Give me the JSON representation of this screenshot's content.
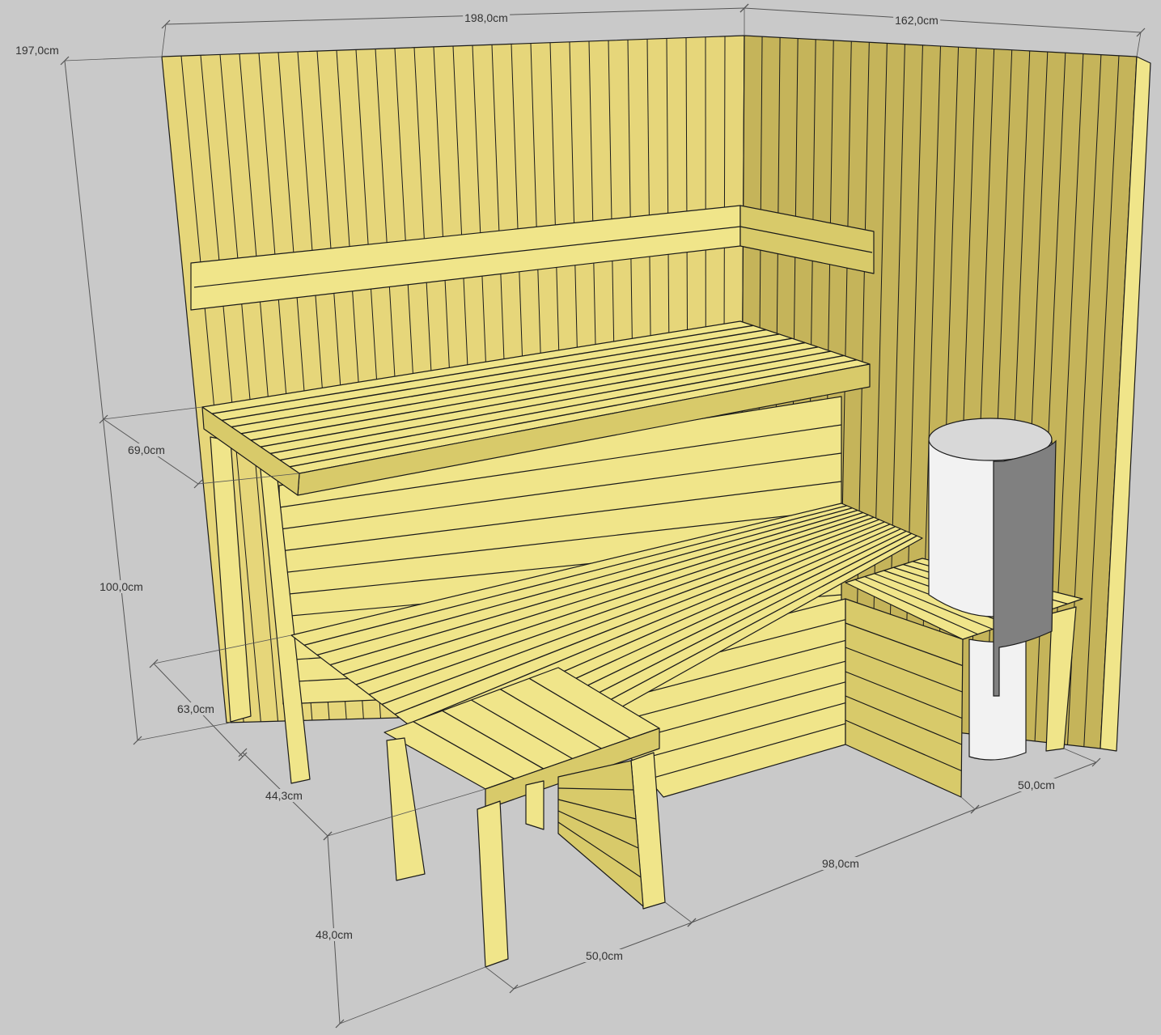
{
  "scene": {
    "description_name": "sauna-3d-model",
    "colors": {
      "background": "#c9c9c9",
      "wood_light": "#f0e58a",
      "wood_mid": "#d8ca6a",
      "wood_dark": "#b4a44e",
      "wall_back": "#e6d67a",
      "wall_side": "#c5b45a",
      "outline": "#1a1a1a",
      "heater_body": "#f2f2f2",
      "heater_shade": "#d8d8d8",
      "heater_guard": "#808080",
      "dimension_line": "#555555"
    }
  },
  "dimensions": {
    "back_wall_width": "198,0cm",
    "side_wall_width": "162,0cm",
    "wall_height": "197,0cm",
    "upper_bench_depth": "69,0cm",
    "upper_bench_height": "100,0cm",
    "lower_bench_depth": "63,0cm",
    "step_offset": "44,3cm",
    "step_height": "48,0cm",
    "step_width": "50,0cm",
    "lower_bench_length": "98,0cm",
    "heater_shelf_depth": "50,0cm"
  }
}
